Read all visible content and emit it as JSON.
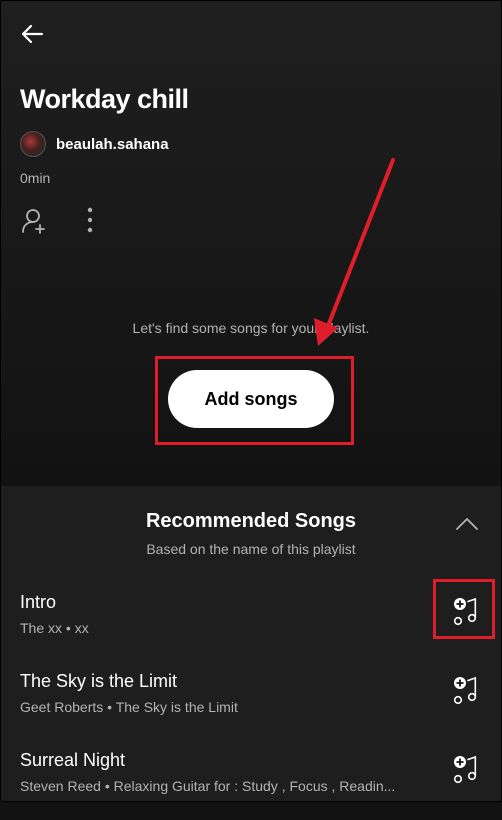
{
  "header": {
    "playlist_title": "Workday chill",
    "owner_name": "beaulah.sahana",
    "duration": "0min"
  },
  "empty_state": {
    "prompt": "Let's find some songs for your playlist.",
    "add_button_label": "Add songs"
  },
  "recommended": {
    "title": "Recommended Songs",
    "subtitle": "Based on the name of this playlist",
    "songs": [
      {
        "title": "Intro",
        "subtitle": "The xx • xx"
      },
      {
        "title": "The Sky is the Limit",
        "subtitle": "Geet Roberts • The Sky is the Limit"
      },
      {
        "title": "Surreal Night",
        "subtitle": "Steven Reed • Relaxing Guitar for : Study , Focus , Readin..."
      }
    ]
  },
  "icons": {
    "back": "arrow-left-icon",
    "add_user": "add-user-icon",
    "more": "more-vertical-icon",
    "collapse": "chevron-up-icon",
    "add_song": "add-song-icon"
  },
  "colors": {
    "background": "#121212",
    "annotation": "#e01d2b",
    "button": "#ffffff"
  }
}
